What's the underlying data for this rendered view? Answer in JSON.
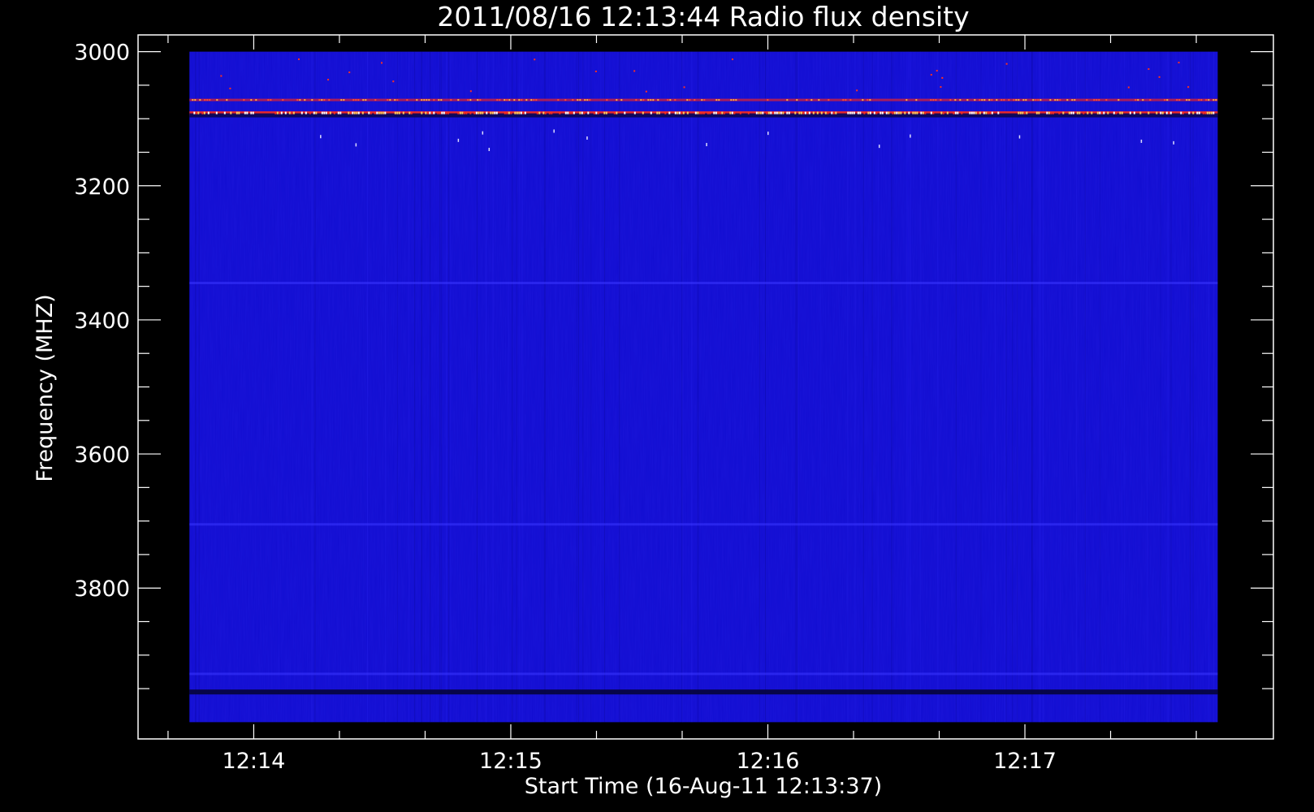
{
  "chart_data": {
    "type": "heatmap",
    "title": "2011/08/16 12:13:44 Radio flux density",
    "xlabel": "Start Time (16-Aug-11 12:13:37)",
    "ylabel": "Frequency (MHZ)",
    "x_ticks": [
      {
        "label": "12:14",
        "value_s": 23
      },
      {
        "label": "12:15",
        "value_s": 83
      },
      {
        "label": "12:16",
        "value_s": 143
      },
      {
        "label": "12:17",
        "value_s": 203
      }
    ],
    "y_ticks": [
      3000,
      3200,
      3400,
      3600,
      3800
    ],
    "xlim_s": [
      -4,
      261
    ],
    "ylim": [
      4025,
      2975
    ],
    "data_extent_s": [
      8,
      248
    ],
    "data_extent_mhz": [
      3000,
      4000
    ],
    "colormap": "blue-red-white",
    "background_level": "low (uniform blue)",
    "features": [
      {
        "type": "band",
        "freq_mhz": 3072,
        "intensity": "high"
      },
      {
        "type": "band",
        "freq_mhz": 3092,
        "intensity": "very high"
      },
      {
        "type": "band",
        "freq_mhz": 3095,
        "intensity": "very low (dark)"
      },
      {
        "type": "band",
        "freq_mhz": 3955,
        "intensity": "low (dark)"
      },
      {
        "type": "band",
        "freq_mhz": 3928,
        "intensity": "slightly elevated"
      },
      {
        "type": "band",
        "freq_mhz": 3705,
        "intensity": "slightly elevated"
      },
      {
        "type": "band",
        "freq_mhz": 3345,
        "intensity": "slightly elevated"
      }
    ]
  },
  "colors": {
    "background": "#000000",
    "axes": "#ffffff",
    "field": "#1a14d8"
  }
}
